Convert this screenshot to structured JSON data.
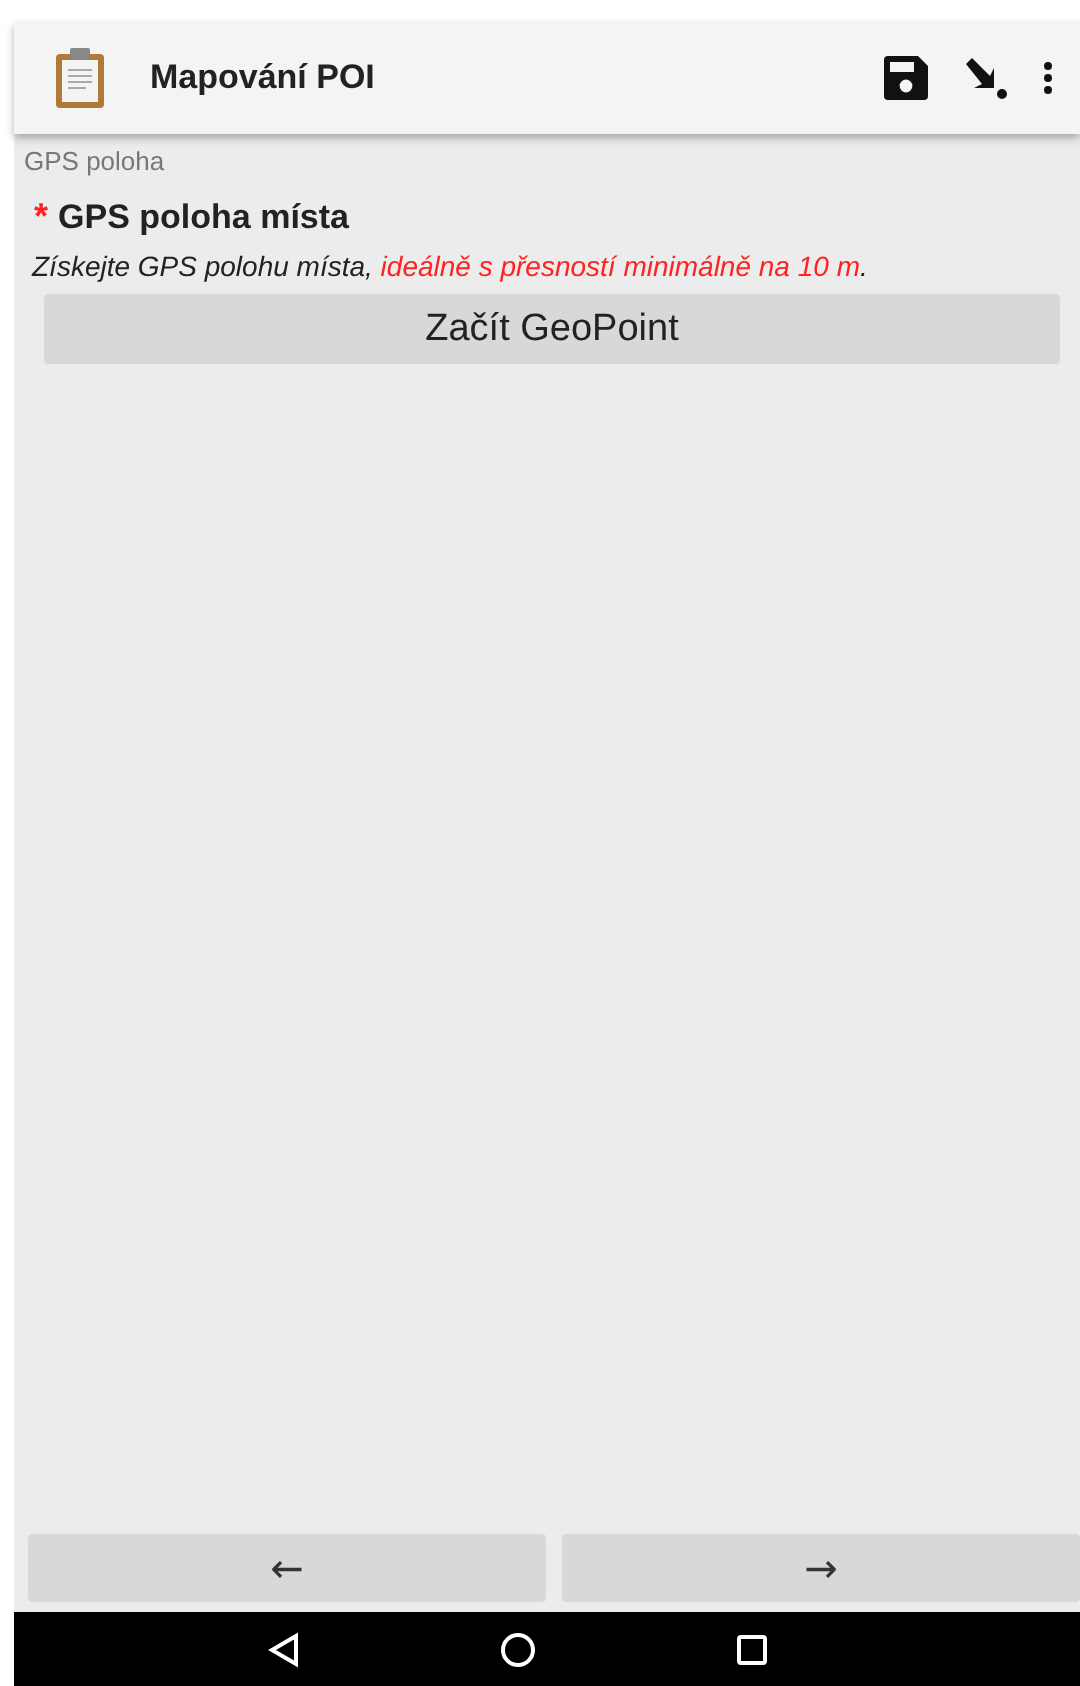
{
  "app_bar": {
    "title": "Mapování POI"
  },
  "group_label": "GPS poloha",
  "question": {
    "required_mark": "*",
    "label": "GPS poloha místa",
    "hint": {
      "text": "Získejte GPS polohu místa, ",
      "highlight": "ideálně s přesností minimálně na 10 m",
      "tail": "."
    },
    "button": "Začít GeoPoint"
  },
  "nav_buttons": [
    "←",
    "→"
  ]
}
